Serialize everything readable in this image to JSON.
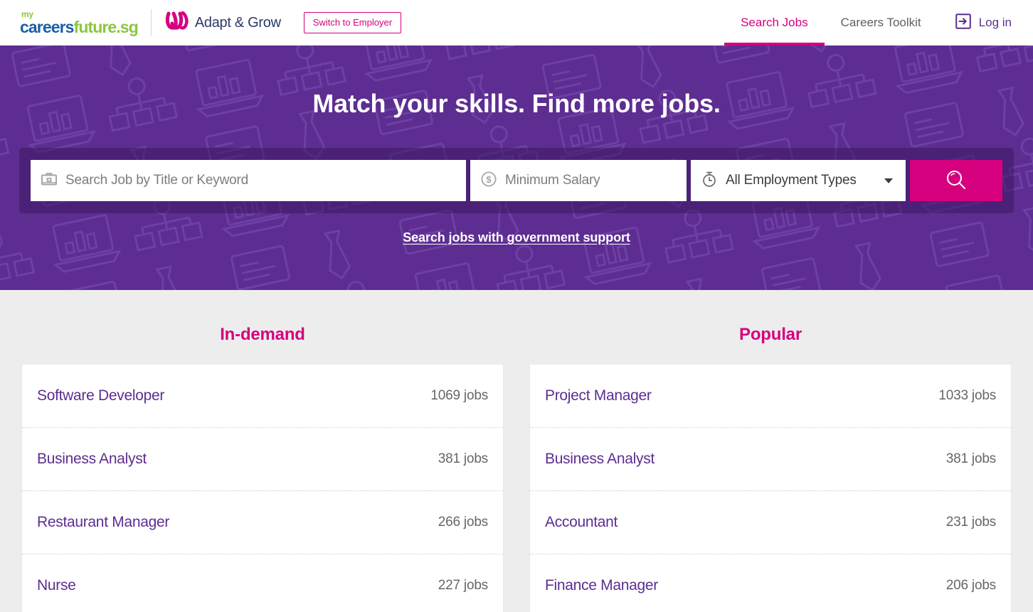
{
  "header": {
    "logo": {
      "my": "my",
      "careers": "careers",
      "future": "future.sg",
      "partner_name": "Adapt & Grow"
    },
    "switch_button_label": "Switch to Employer",
    "nav": [
      {
        "label": "Search Jobs",
        "active": true
      },
      {
        "label": "Careers Toolkit",
        "active": false
      }
    ],
    "login_label": "Log in",
    "login_icon": "login-arrow-icon",
    "active_color": "#d6007f",
    "inactive_color": "#606060",
    "login_color": "#5b2d90"
  },
  "hero": {
    "title": "Match your skills. Find more jobs.",
    "background_color": "#5d2d91",
    "search": {
      "keyword_placeholder": "Search Job by Title or Keyword",
      "keyword_icon": "briefcase-icon",
      "keyword_value": "",
      "salary_placeholder": "Minimum Salary",
      "salary_icon": "dollar-coin-icon",
      "salary_value": "",
      "employment_type_value": "All Employment Types",
      "employment_type_icon": "stopwatch-icon",
      "employment_type_options": [
        "All Employment Types"
      ],
      "search_button_icon": "search-icon",
      "search_button_color": "#d6007f"
    },
    "gov_support_link": "Search jobs with government support"
  },
  "main": {
    "columns": [
      {
        "title": "In-demand",
        "jobs": [
          {
            "title": "Software Developer",
            "count": "1069 jobs"
          },
          {
            "title": "Business Analyst",
            "count": "381 jobs"
          },
          {
            "title": "Restaurant Manager",
            "count": "266 jobs"
          },
          {
            "title": "Nurse",
            "count": "227 jobs"
          }
        ]
      },
      {
        "title": "Popular",
        "jobs": [
          {
            "title": "Project Manager",
            "count": "1033 jobs"
          },
          {
            "title": "Business Analyst",
            "count": "381 jobs"
          },
          {
            "title": "Accountant",
            "count": "231 jobs"
          },
          {
            "title": "Finance Manager",
            "count": "206 jobs"
          }
        ]
      }
    ],
    "title_color": "#d6007f",
    "job_title_color": "#5d2d91",
    "job_count_color": "#666666",
    "background_color": "#ededed"
  }
}
